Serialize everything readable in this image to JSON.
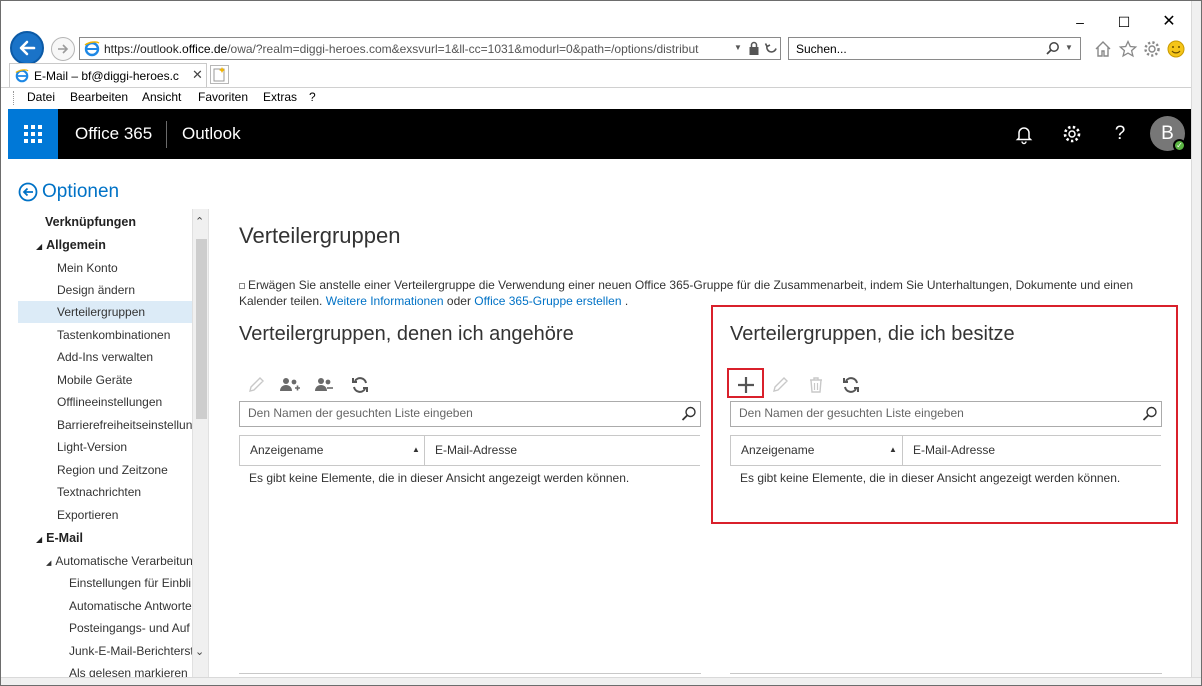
{
  "browser": {
    "url_host": "https://outlook.",
    "url_domain": "office.de",
    "url_rest": "/owa/?realm=diggi-heroes.com&exsvurl=1&ll-cc=1031&modurl=0&path=/options/distribut",
    "search_placeholder": "Suchen...",
    "tab_title": "E-Mail – bf@diggi-heroes.c",
    "menu": [
      "Datei",
      "Bearbeiten",
      "Ansicht",
      "Favoriten",
      "Extras",
      "?"
    ]
  },
  "header": {
    "brand": "Office 365",
    "app": "Outlook",
    "avatar_initial": "B",
    "help": "?"
  },
  "options": {
    "title": "Optionen"
  },
  "sidebar": {
    "items": [
      {
        "label": "Verknüpfungen"
      },
      {
        "label": "Allgemein"
      },
      {
        "label": "Mein Konto"
      },
      {
        "label": "Design ändern"
      },
      {
        "label": "Verteilergruppen"
      },
      {
        "label": "Tastenkombinationen"
      },
      {
        "label": "Add-Ins verwalten"
      },
      {
        "label": "Mobile Geräte"
      },
      {
        "label": "Offlineeinstellungen"
      },
      {
        "label": "Barrierefreiheitseinstellun"
      },
      {
        "label": "Light-Version"
      },
      {
        "label": "Region und Zeitzone"
      },
      {
        "label": "Textnachrichten"
      },
      {
        "label": "Exportieren"
      },
      {
        "label": "E-Mail"
      },
      {
        "label": "Automatische Verarbeitun"
      },
      {
        "label": "Einstellungen für Einbli"
      },
      {
        "label": "Automatische Antworte"
      },
      {
        "label": "Posteingangs- und Auf"
      },
      {
        "label": "Junk-E-Mail-Berichterst"
      },
      {
        "label": "Als gelesen markieren"
      }
    ]
  },
  "main": {
    "title": "Verteilergruppen",
    "info_text": "Erwägen Sie anstelle einer Verteilergruppe die Verwendung einer neuen Office 365-Gruppe für die Zusammenarbeit, indem Sie Unterhaltungen, Dokumente und einen Kalender teilen.",
    "info_link1": "Weitere Informationen",
    "info_or": "oder",
    "info_link2": "Office 365-Gruppe erstellen",
    "info_end": ".",
    "left": {
      "title": "Verteilergruppen, denen ich angehöre",
      "search_placeholder": "Den Namen der gesuchten Liste eingeben",
      "col_name": "Anzeigename",
      "col_email": "E-Mail-Adresse",
      "empty": "Es gibt keine Elemente, die in dieser Ansicht angezeigt werden können."
    },
    "right": {
      "title": "Verteilergruppen, die ich besitze",
      "search_placeholder": "Den Namen der gesuchten Liste eingeben",
      "col_name": "Anzeigename",
      "col_email": "E-Mail-Adresse",
      "empty": "Es gibt keine Elemente, die in dieser Ansicht angezeigt werden können."
    }
  },
  "colors": {
    "accent": "#0072c6",
    "waffle": "#0078d7",
    "highlight": "#d9202b",
    "selected_bg": "#dcebf7"
  }
}
